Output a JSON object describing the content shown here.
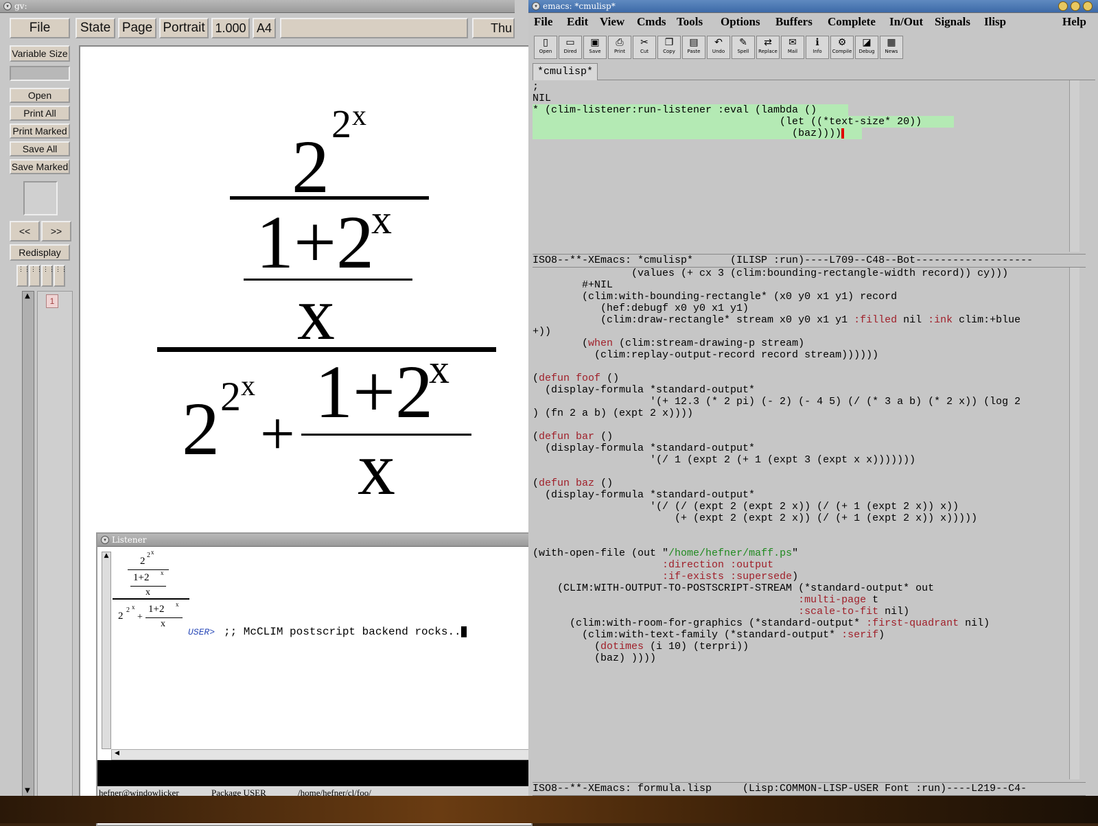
{
  "gv": {
    "title": "gv:",
    "file_button": "File",
    "top_buttons": [
      "State",
      "Page",
      "Portrait",
      "1.000",
      "A4"
    ],
    "date_label": "Thu",
    "side_buttons": [
      "Variable Size",
      "Open",
      "Print All",
      "Print Marked",
      "Save All",
      "Save Marked"
    ],
    "prev_label": "<<",
    "next_label": ">>",
    "redisplay_label": "Redisplay",
    "page_number": "1",
    "formula": {
      "big_numer_base": "2",
      "big_numer_exp1": "2",
      "big_numer_exp2": "x",
      "one_plus_two": "1+2",
      "x_sup": "x",
      "x_den": "x",
      "plus": "+"
    }
  },
  "listener": {
    "title": "Listener",
    "prompt": "USER>",
    "command": ";; McCLIM postscript backend rocks..",
    "status_host": "hefner@windowlicker",
    "status_package": "Package USER",
    "status_path": "/home/hefner/cl/foo/"
  },
  "emacs": {
    "title": "emacs: *cmulisp*",
    "menu": [
      "File",
      "Edit",
      "View",
      "Cmds",
      "Tools",
      "Options",
      "Buffers",
      "Complete",
      "In/Out",
      "Signals",
      "Ilisp"
    ],
    "help": "Help",
    "toolbar": [
      "Open",
      "Dired",
      "Save",
      "Print",
      "Cut",
      "Copy",
      "Paste",
      "Undo",
      "Spell",
      "Replace",
      "Mail",
      "Info",
      "Compile",
      "Debug",
      "News"
    ],
    "tab": "*cmulisp*",
    "top_lines": [
      ";",
      "NIL"
    ],
    "prompt_lines": [
      "* (clim-listener:run-listener :eval (lambda () ",
      "                                        (let ((*text-size* 20))",
      "                                          (baz))))"
    ],
    "modeline1": "ISO8--**-XEmacs: *cmulisp*      (ILISP :run)----L709--C48--Bot-------------------",
    "modeline2": "ISO8--**-XEmacs: formula.lisp     (Lisp:COMMON-LISP-USER Font :run)----L219--C4-"
  },
  "colors": {
    "code_keyword": "#a0202a",
    "code_string": "#208a20",
    "highlight": "#b4eab4",
    "title_active": "#3d6aa8"
  }
}
